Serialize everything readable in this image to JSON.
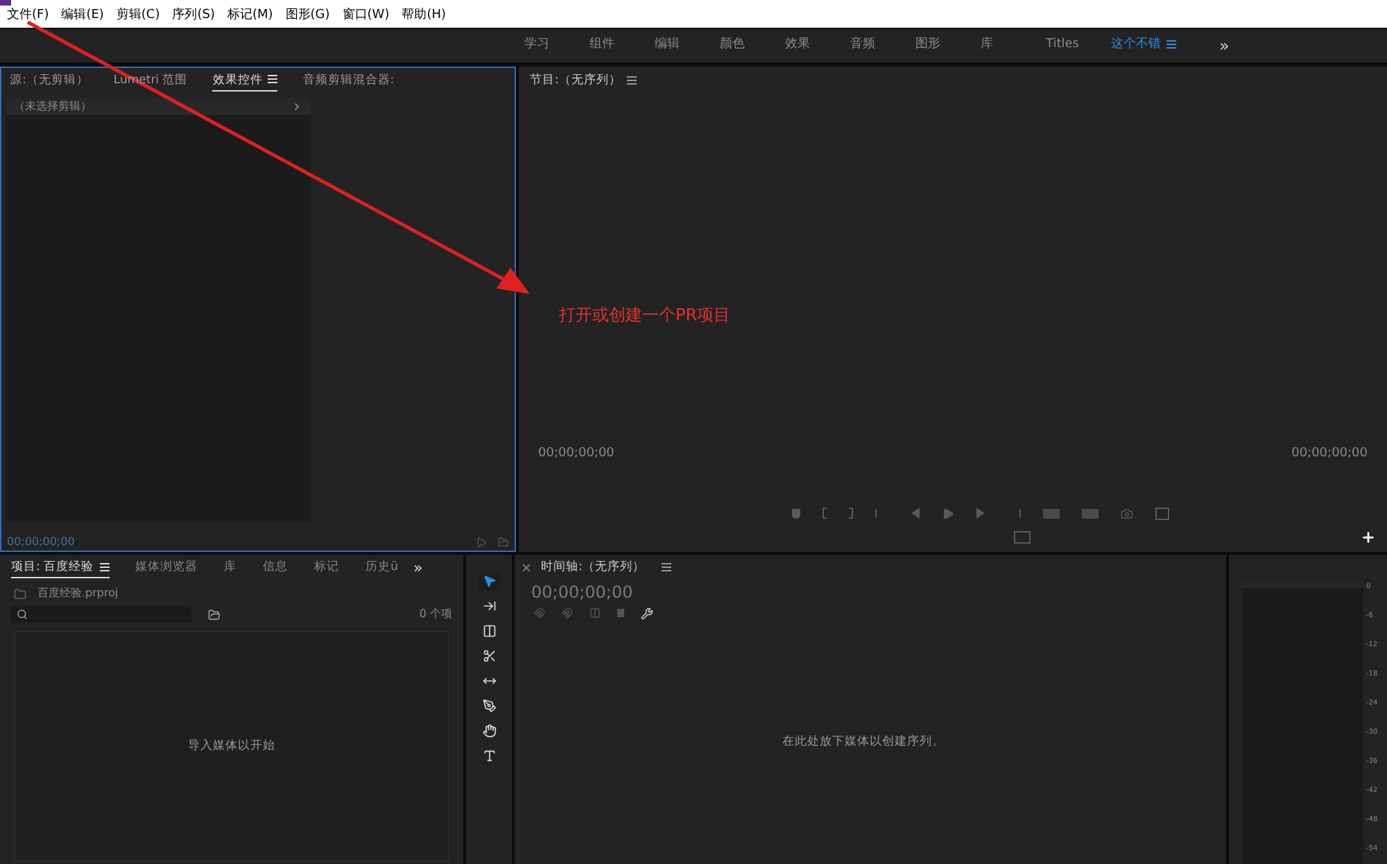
{
  "menu": [
    "文件(F)",
    "编辑(E)",
    "剪辑(C)",
    "序列(S)",
    "标记(M)",
    "图形(G)",
    "窗口(W)",
    "帮助(H)"
  ],
  "workspaces": [
    {
      "label": "学习",
      "selected": false
    },
    {
      "label": "组件",
      "selected": false
    },
    {
      "label": "编辑",
      "selected": false
    },
    {
      "label": "颜色",
      "selected": false
    },
    {
      "label": "效果",
      "selected": false
    },
    {
      "label": "音频",
      "selected": false
    },
    {
      "label": "图形",
      "selected": false
    },
    {
      "label": "库",
      "selected": false
    },
    {
      "label": "Titles",
      "selected": false
    },
    {
      "label": "这个不错",
      "selected": true
    }
  ],
  "workspace_more": "»",
  "source_panel": {
    "tabs": [
      {
        "label": "源:（无剪辑）",
        "selected": false
      },
      {
        "label": "Lumetri 范围",
        "selected": false
      },
      {
        "label": "效果控件",
        "selected": true
      },
      {
        "label": "音频剪辑混合器:",
        "selected": false
      }
    ],
    "clip_header": "（未选择剪辑）",
    "timecode": "00;00;00;00"
  },
  "program_panel": {
    "title": "节目:（无序列）",
    "timecode_left": "00;00;00;00",
    "timecode_right": "00;00;00;00"
  },
  "annotation": "打开或创建一个PR项目",
  "project_panel": {
    "tabs": [
      {
        "label": "项目: 百度经验",
        "selected": true
      },
      {
        "label": "媒体浏览器",
        "selected": false
      },
      {
        "label": "库",
        "selected": false
      },
      {
        "label": "信息",
        "selected": false
      },
      {
        "label": "标记",
        "selected": false
      },
      {
        "label": "历史ü",
        "selected": false
      }
    ],
    "more": "»",
    "file": "百度经验.prproj",
    "count": "0 个项",
    "empty_text": "导入媒体以开始"
  },
  "tools": [
    {
      "kind": "select",
      "selected": true
    },
    {
      "kind": "track",
      "selected": false
    },
    {
      "kind": "ripple",
      "selected": false
    },
    {
      "kind": "razor",
      "selected": false
    },
    {
      "kind": "slip",
      "selected": false
    },
    {
      "kind": "pen",
      "selected": false
    },
    {
      "kind": "hand",
      "selected": false
    },
    {
      "kind": "type",
      "selected": false
    }
  ],
  "timeline": {
    "title": "时间轴:（无序列）",
    "timecode": "00;00;00;00",
    "empty_text": "在此处放下媒体以创建序列。"
  },
  "meter_ticks": [
    "0",
    "-6",
    "-12",
    "-18",
    "-24",
    "-30",
    "-36",
    "-42",
    "-48",
    "-54"
  ]
}
